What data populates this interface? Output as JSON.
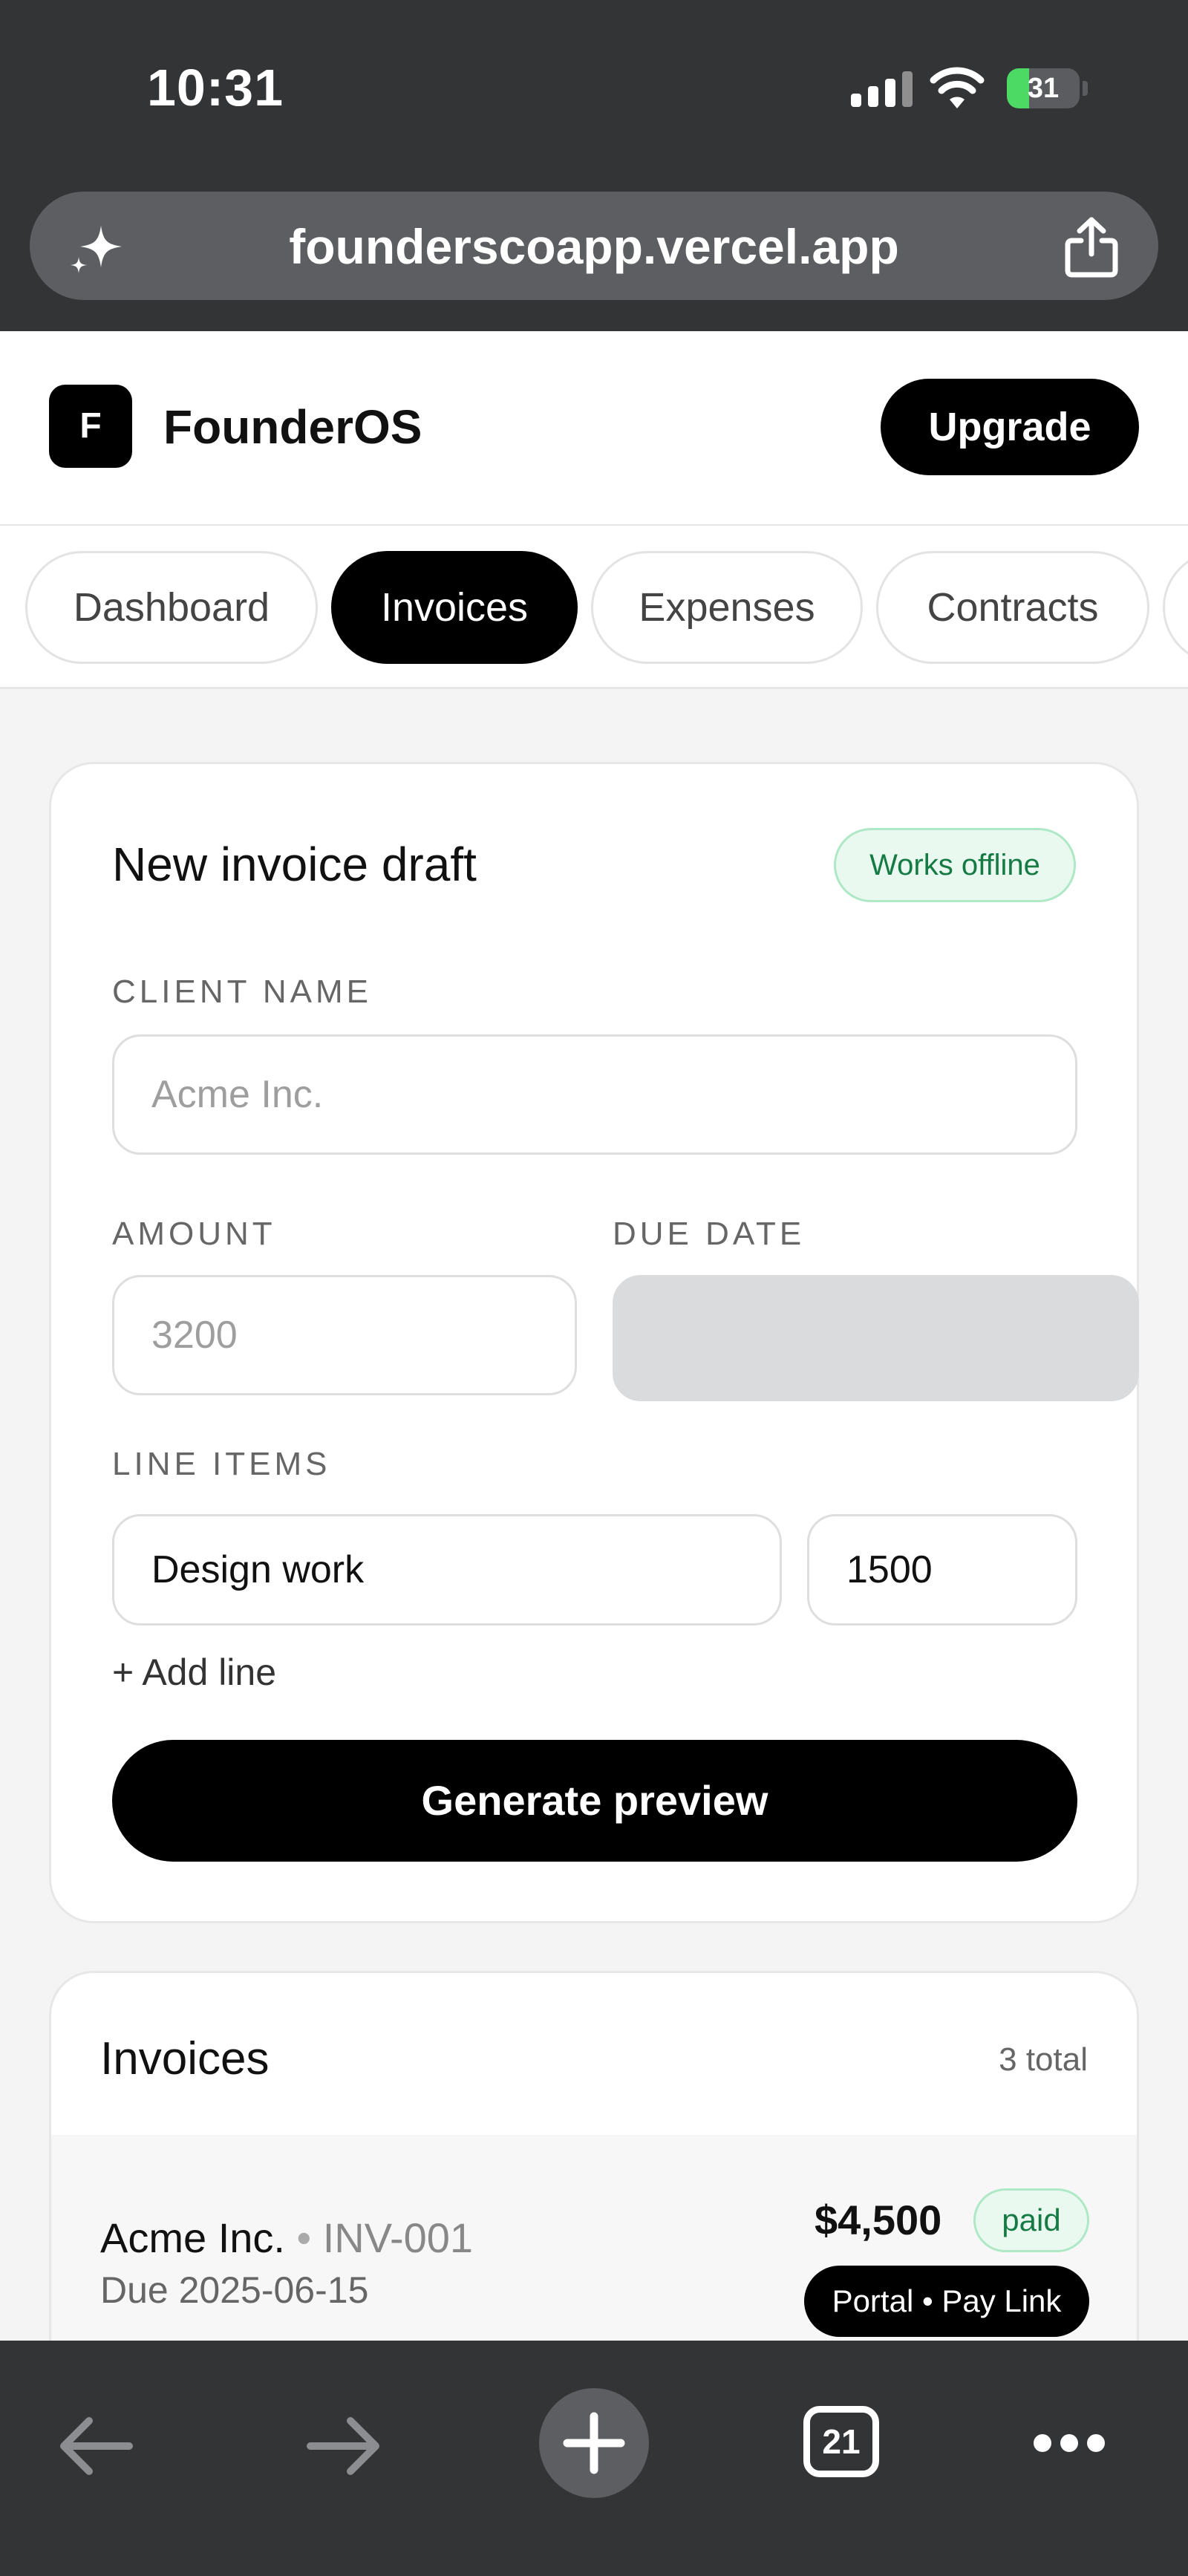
{
  "status_bar": {
    "time": "10:31",
    "battery": "31",
    "battery_level": 0.31,
    "battery_color": "#4cd964"
  },
  "browser": {
    "url": "founderscoapp.vercel.app",
    "left_icon": "sparkle-icon",
    "right_icon": "share-icon"
  },
  "header": {
    "logo_letter": "F",
    "brand": "FounderOS",
    "upgrade_label": "Upgrade"
  },
  "tabs": [
    {
      "label": "Dashboard",
      "active": false
    },
    {
      "label": "Invoices",
      "active": true
    },
    {
      "label": "Expenses",
      "active": false
    },
    {
      "label": "Contracts",
      "active": false
    }
  ],
  "form": {
    "title": "New invoice draft",
    "offline_badge": "Works offline",
    "client_label": "CLIENT NAME",
    "client_placeholder": "Acme Inc.",
    "amount_label": "AMOUNT",
    "amount_placeholder": "3200",
    "due_label": "DUE DATE",
    "line_items_label": "LINE ITEMS",
    "line_item_desc": "Design work",
    "line_item_amount": "1500",
    "add_line": "+ Add line",
    "generate_label": "Generate preview"
  },
  "invoices": {
    "title": "Invoices",
    "count": "3 total",
    "rows": [
      {
        "client": "Acme Inc.",
        "separator": "•",
        "number": "INV-001",
        "due": "Due 2025-06-15",
        "amount": "$4,500",
        "status": "paid",
        "action": "Portal • Pay Link"
      }
    ]
  },
  "toolbar": {
    "back_icon": "back-arrow-icon",
    "forward_icon": "forward-arrow-icon",
    "new_tab_icon": "plus-icon",
    "tab_count": "21",
    "more_icon": "more-icon"
  },
  "colors": {
    "accent": "#000000",
    "success_bg": "#e9f9f0",
    "success_text": "#167a45",
    "chrome": "#333436"
  }
}
